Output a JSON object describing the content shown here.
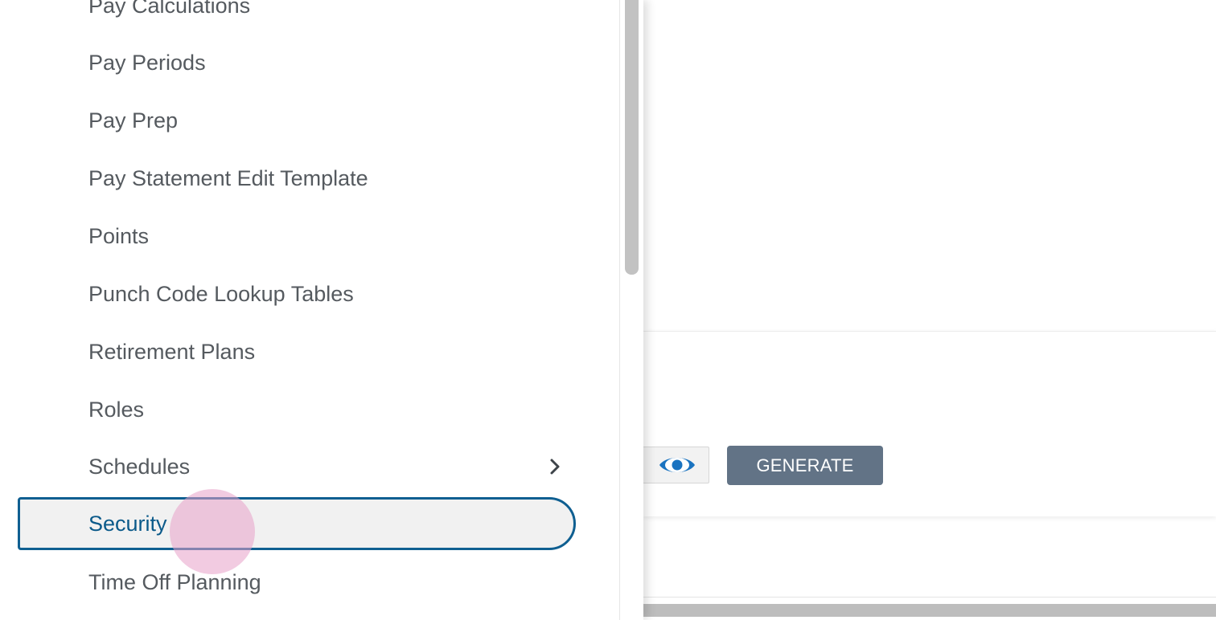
{
  "menu": {
    "items": [
      {
        "label": "Pay Calculations"
      },
      {
        "label": "Pay Periods"
      },
      {
        "label": "Pay Prep"
      },
      {
        "label": "Pay Statement Edit Template"
      },
      {
        "label": "Points"
      },
      {
        "label": "Punch Code Lookup Tables"
      },
      {
        "label": "Retirement Plans"
      },
      {
        "label": "Roles"
      },
      {
        "label": "Schedules",
        "has_submenu": true
      },
      {
        "label": "Security",
        "active": true
      },
      {
        "label": "Time Off Planning"
      }
    ],
    "chevron_icon": "chevron-right-icon"
  },
  "actions": {
    "preview_icon": "eye-icon",
    "generate_label": "GENERATE"
  },
  "colors": {
    "accent": "#0f5f91",
    "active_text": "#0b5a8a",
    "menu_text": "#555a5f",
    "generate_bg": "#627386",
    "eye_icon": "#1a73c0",
    "click_indicator": "#e7a0c8"
  }
}
